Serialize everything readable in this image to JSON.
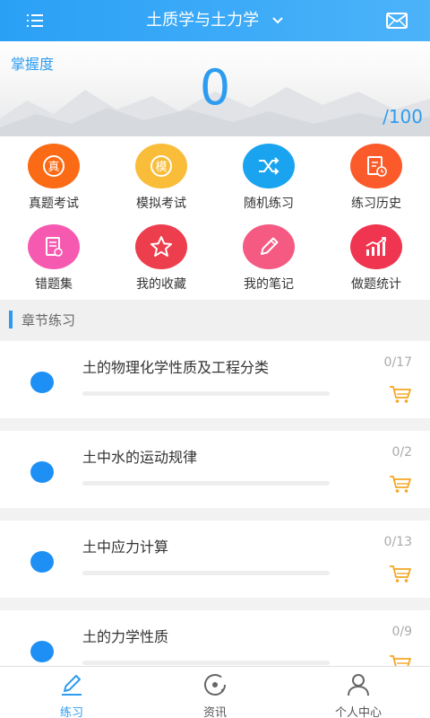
{
  "header": {
    "title": "土质学与土力学",
    "menu_icon": "menu-icon",
    "mail_icon": "mail-icon"
  },
  "banner": {
    "mastery_label": "掌握度",
    "score": "0",
    "total": "/100"
  },
  "grid": [
    {
      "label": "真题考试",
      "icon": "real-exam-icon",
      "color": "#fb6a14",
      "glyph": "真"
    },
    {
      "label": "模拟考试",
      "icon": "mock-exam-icon",
      "color": "#f9bd3a",
      "glyph": "模"
    },
    {
      "label": "随机练习",
      "icon": "shuffle-icon",
      "color": "#1aa4ef"
    },
    {
      "label": "练习历史",
      "icon": "history-icon",
      "color": "#fb5b2b"
    },
    {
      "label": "错题集",
      "icon": "wrong-questions-icon",
      "color": "#f65ab0"
    },
    {
      "label": "我的收藏",
      "icon": "star-icon",
      "color": "#ed3e4e"
    },
    {
      "label": "我的笔记",
      "icon": "pencil-icon",
      "color": "#f45a82"
    },
    {
      "label": "做题统计",
      "icon": "stats-icon",
      "color": "#ef3550"
    }
  ],
  "section": {
    "title": "章节练习"
  },
  "chapters": [
    {
      "title": "土的物理化学性质及工程分类",
      "count": "0/17",
      "progress": 0
    },
    {
      "title": "土中水的运动规律",
      "count": "0/2",
      "progress": 0
    },
    {
      "title": "土中应力计算",
      "count": "0/13",
      "progress": 0
    },
    {
      "title": "土的力学性质",
      "count": "0/9",
      "progress": 0
    }
  ],
  "tabs": [
    {
      "label": "练习",
      "icon": "practice-pen-icon",
      "active": true
    },
    {
      "label": "资讯",
      "icon": "news-icon",
      "active": false
    },
    {
      "label": "个人中心",
      "icon": "user-icon",
      "active": false
    }
  ],
  "colors": {
    "accent": "#2d9cf0",
    "cart": "#f5a623"
  }
}
